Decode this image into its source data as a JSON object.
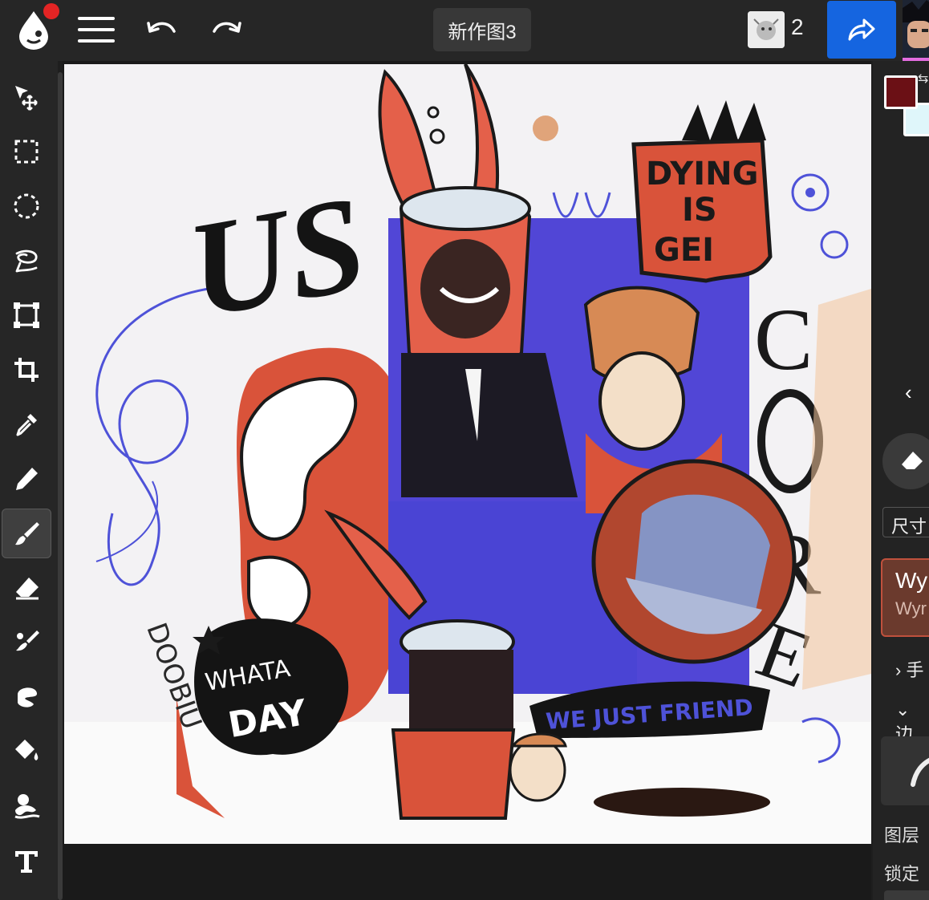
{
  "topbar": {
    "document_title": "新作图3",
    "collaborator_count": "2",
    "share_color": "#1565e0"
  },
  "toolbar": {
    "tools": [
      {
        "name": "move-transform",
        "icon": "move-icon"
      },
      {
        "name": "rect-select",
        "icon": "rect-select-icon"
      },
      {
        "name": "ellipse-select",
        "icon": "ellipse-select-icon"
      },
      {
        "name": "lasso-select",
        "icon": "lasso-icon"
      },
      {
        "name": "transform",
        "icon": "transform-icon"
      },
      {
        "name": "crop",
        "icon": "crop-icon"
      },
      {
        "name": "eyedropper",
        "icon": "eyedropper-icon"
      },
      {
        "name": "pencil",
        "icon": "pencil-icon"
      },
      {
        "name": "brush",
        "icon": "brush-icon",
        "active": true
      },
      {
        "name": "eraser",
        "icon": "eraser-icon"
      },
      {
        "name": "blend",
        "icon": "blend-icon"
      },
      {
        "name": "smudge",
        "icon": "smudge-icon"
      },
      {
        "name": "fill",
        "icon": "paint-bucket-icon"
      },
      {
        "name": "liquify",
        "icon": "liquify-icon"
      },
      {
        "name": "text",
        "icon": "text-icon"
      }
    ]
  },
  "canvas": {
    "artwork_texts": [
      "US",
      "DYING IS GEI",
      "CORE",
      "WHAT A DAY",
      "WE JUST FRIEND",
      "DOOBIU"
    ]
  },
  "panel": {
    "primary_color": "#6b1015",
    "secondary_color": "#dff6fa",
    "size_label": "尺寸",
    "brush_name": "Wy",
    "brush_subname": "Wyr",
    "row1_label": "手",
    "row2_label": "边",
    "layers_label": "图层",
    "lock_label": "锁定"
  }
}
